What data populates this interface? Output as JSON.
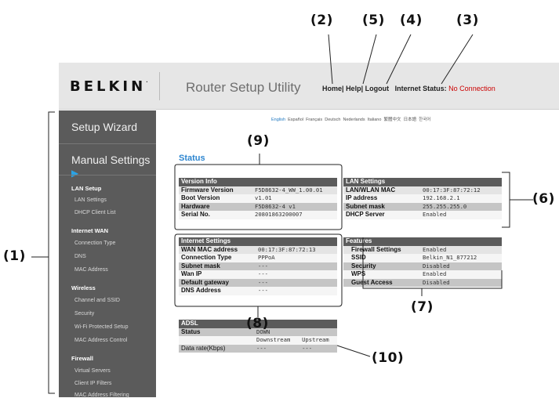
{
  "brand": {
    "name": "BELKIN",
    "mark": "."
  },
  "app_title": "Router Setup Utility",
  "topnav": {
    "home": "Home",
    "sep1": "|",
    "help": "Help",
    "sep2": "|",
    "logout": "Logout",
    "internet_status_label": "Internet Status:",
    "internet_status_value": "No Connection"
  },
  "languages": {
    "english": "English",
    "espanol": "Español",
    "francais": "Français",
    "deutsch": "Deutsch",
    "nederlands": "Nederlands",
    "italiano": "Italiano",
    "chinese": "繁體中文",
    "japanese": "日本語",
    "korean": "한국어"
  },
  "sidebar": {
    "setup_wizard": "Setup Wizard",
    "manual_settings": "Manual Settings",
    "lan_setup": "LAN Setup",
    "lan_settings": "LAN Settings",
    "dhcp_client_list": "DHCP Client List",
    "internet_wan": "Internet WAN",
    "connection_type": "Connection Type",
    "dns": "DNS",
    "mac_address": "MAC Address",
    "wireless": "Wireless",
    "channel_ssid": "Channel and SSID",
    "security": "Security",
    "wps": "Wi-Fi Protected Setup",
    "mac_address_control": "MAC Address Control",
    "firewall": "Firewall",
    "virtual_servers": "Virtual Servers",
    "client_ip_filters": "Client IP Filters",
    "mac_address_filtering": "MAC Address Filtering"
  },
  "status_title": "Status",
  "version_info": {
    "title": "Version Info",
    "rows": [
      {
        "label": "Firmware Version",
        "value": "F5D8632-4_WW_1.00.01"
      },
      {
        "label": "Boot Version",
        "value": "v1.01"
      },
      {
        "label": "Hardware",
        "value": "F5D8632-4 v1"
      },
      {
        "label": "Serial No.",
        "value": "20801863200007"
      }
    ]
  },
  "lan_settings": {
    "title": "LAN Settings",
    "rows": [
      {
        "label": "LAN/WLAN MAC",
        "value": "00:17:3F:87:72:12"
      },
      {
        "label": "IP address",
        "value": "192.168.2.1"
      },
      {
        "label": "Subnet mask",
        "value": "255.255.255.0"
      },
      {
        "label": "DHCP Server",
        "value": "Enabled"
      }
    ]
  },
  "internet_settings": {
    "title": "Internet Settings",
    "rows": [
      {
        "label": "WAN MAC address",
        "value": "00:17:3F:87:72:13"
      },
      {
        "label": "Connection Type",
        "value": "PPPoA"
      },
      {
        "label": "Subnet mask",
        "value": "---"
      },
      {
        "label": "Wan IP",
        "value": "---"
      },
      {
        "label": "Default gateway",
        "value": "---"
      },
      {
        "label": "DNS Address",
        "value": "---"
      }
    ]
  },
  "features": {
    "title": "Features",
    "rows": [
      {
        "label": "Firewall Settings",
        "value": "Enabled"
      },
      {
        "label": "SSID",
        "value": "Belkin_N1_877212"
      },
      {
        "label": "Security",
        "value": "Disabled"
      },
      {
        "label": "WPS",
        "value": "Enabled"
      },
      {
        "label": "Guest Access",
        "value": "Disabled"
      }
    ]
  },
  "adsl": {
    "title": "ADSL",
    "status_label": "Status",
    "status_value": "DOWN",
    "downstream": "Downstream",
    "upstream": "Upstream",
    "rate_label": "Data rate(Kbps)",
    "rate_down": "---",
    "rate_up": "---"
  },
  "callouts": {
    "c1": "(1)",
    "c2": "(2)",
    "c3": "(3)",
    "c4": "(4)",
    "c5": "(5)",
    "c6": "(6)",
    "c7": "(7)",
    "c8": "(8)",
    "c9": "(9)",
    "c10": "(10)"
  }
}
